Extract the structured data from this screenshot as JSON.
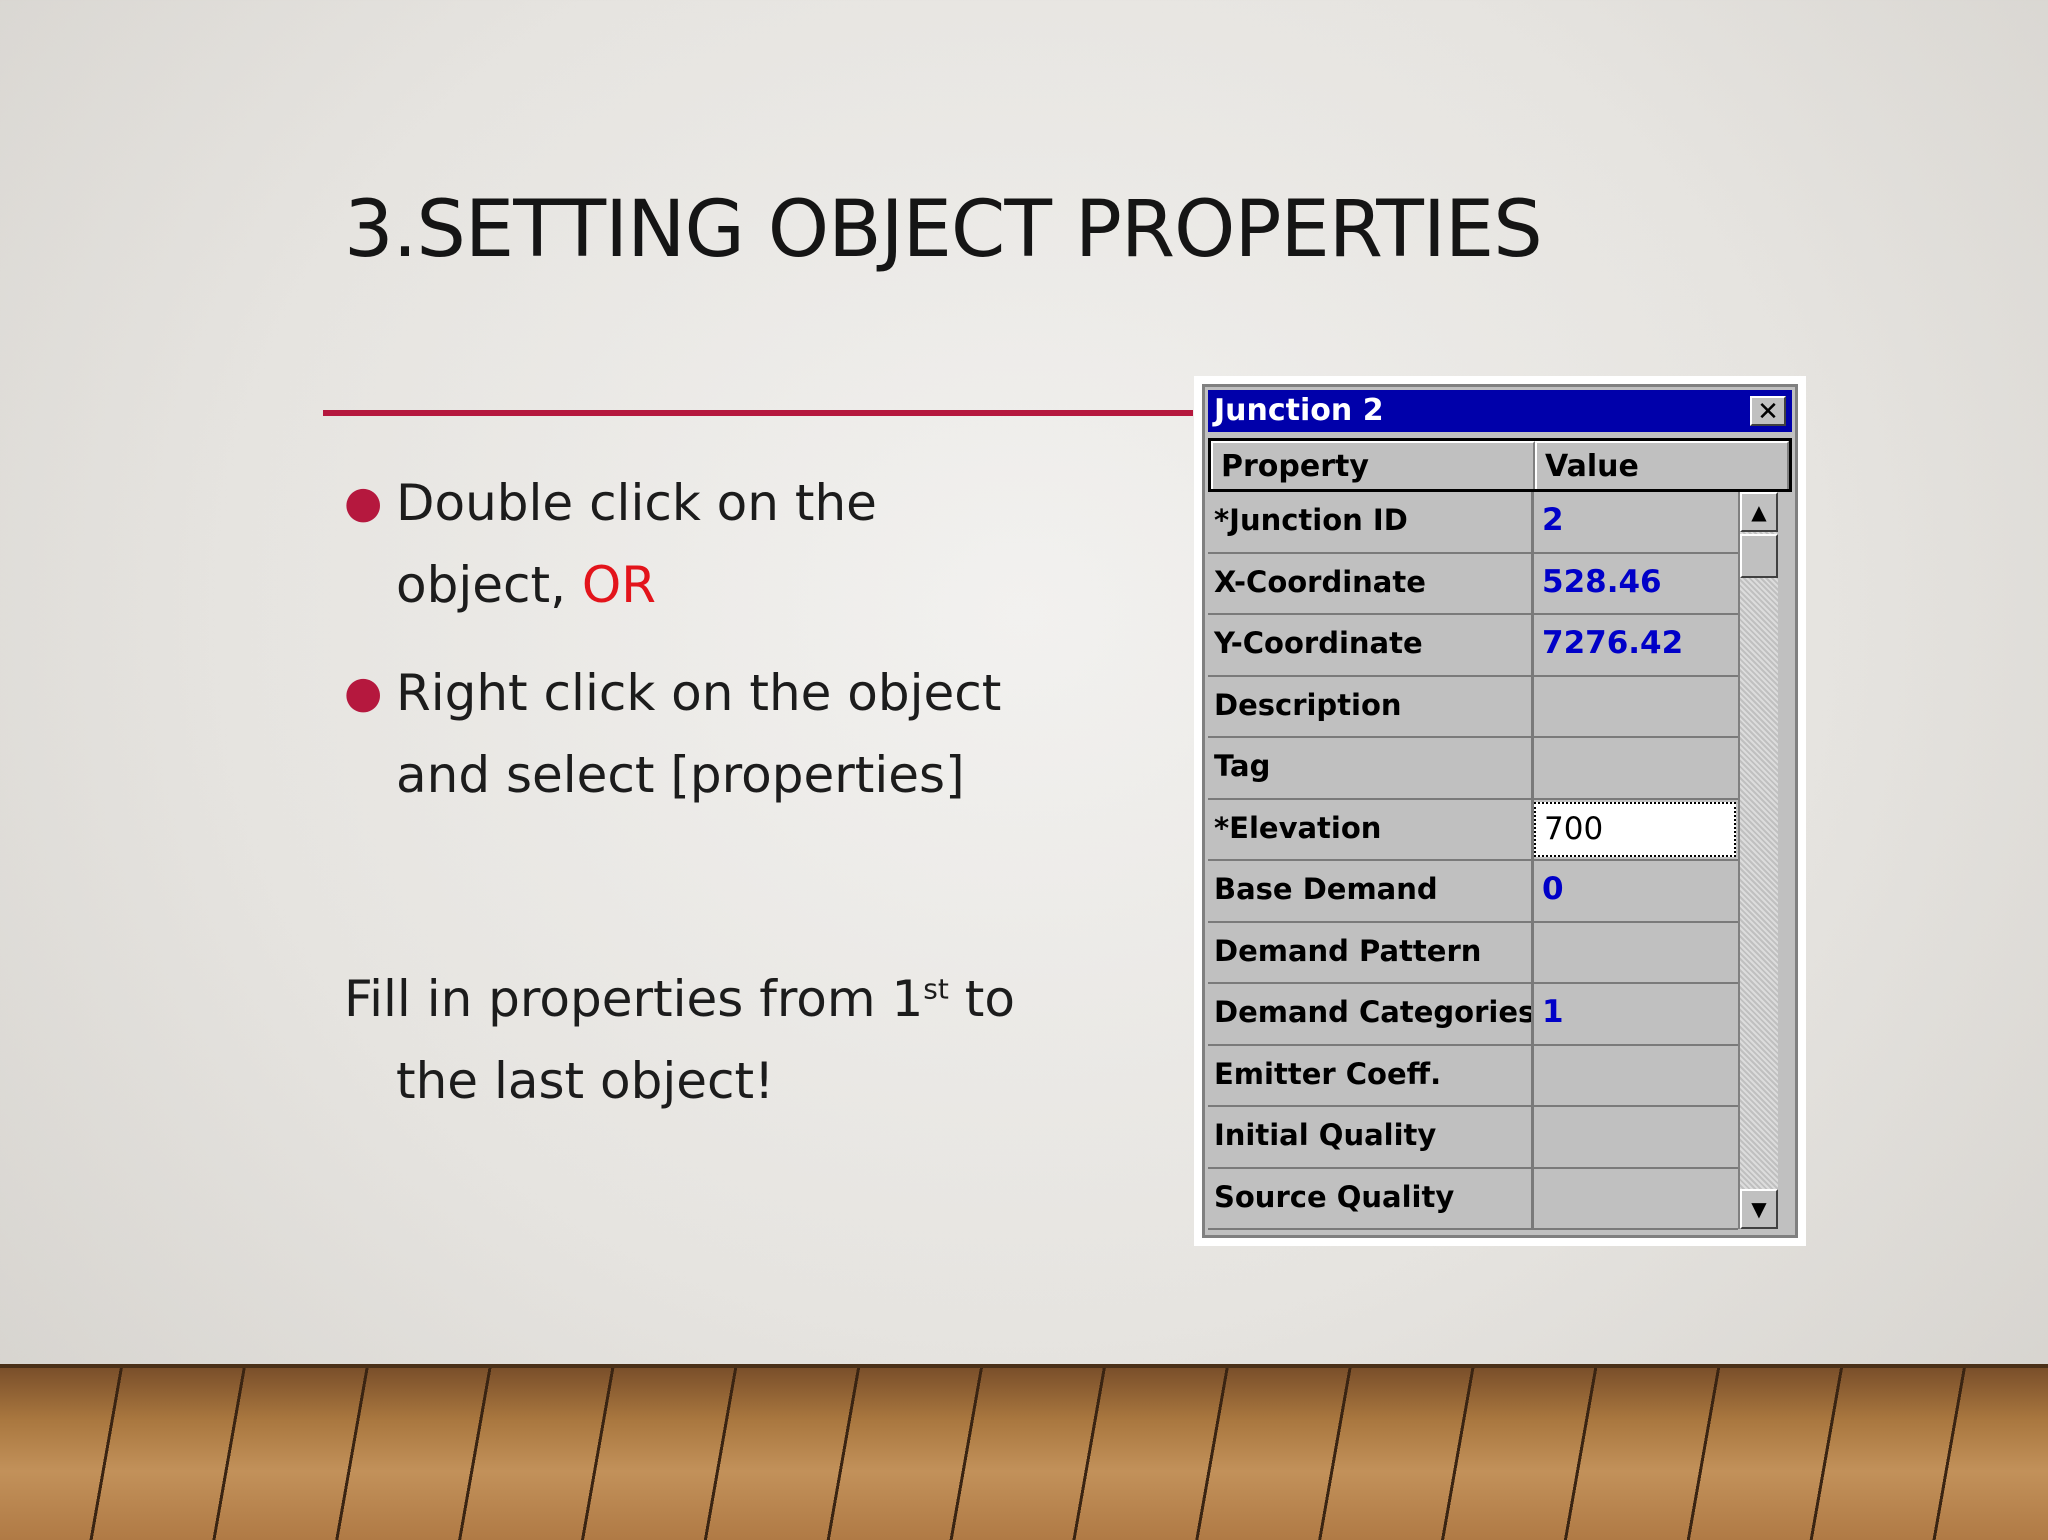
{
  "slide": {
    "title": "3.SETTING OBJECT PROPERTIES",
    "bullets": [
      {
        "text_before": "Double click on the object, ",
        "text_red": "OR"
      },
      {
        "text_before": "Right click on the object and select [properties]",
        "text_red": ""
      }
    ],
    "fill_line1_a": "Fill in properties from 1",
    "fill_sup": "st",
    "fill_line1_b": " to",
    "fill_line2": "the last object!",
    "accent_color": "#b5183e",
    "highlight_color": "#e3141b"
  },
  "dialog": {
    "title": "Junction 2",
    "close_glyph": "✕",
    "headers": {
      "property": "Property",
      "value": "Value"
    },
    "rows": [
      {
        "property": "*Junction ID",
        "value": "2"
      },
      {
        "property": "X-Coordinate",
        "value": "528.46"
      },
      {
        "property": "Y-Coordinate",
        "value": "7276.42"
      },
      {
        "property": "Description",
        "value": ""
      },
      {
        "property": "Tag",
        "value": ""
      },
      {
        "property": "*Elevation",
        "value": "700",
        "editing": true
      },
      {
        "property": "Base Demand",
        "value": "0"
      },
      {
        "property": "Demand Pattern",
        "value": ""
      },
      {
        "property": "Demand Categories",
        "value": "1"
      },
      {
        "property": "Emitter Coeff.",
        "value": ""
      },
      {
        "property": "Initial Quality",
        "value": ""
      },
      {
        "property": "Source Quality",
        "value": ""
      }
    ],
    "scroll_up_glyph": "▲",
    "scroll_down_glyph": "▼"
  }
}
